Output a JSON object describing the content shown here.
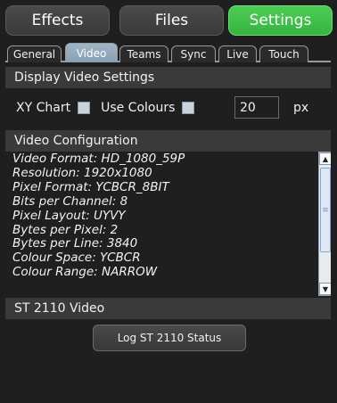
{
  "modes": [
    {
      "label": "Effects",
      "active": false
    },
    {
      "label": "Files",
      "active": false
    },
    {
      "label": "Settings",
      "active": true
    }
  ],
  "subtabs": [
    {
      "label": "General",
      "active": false
    },
    {
      "label": "Video",
      "active": true
    },
    {
      "label": "Teams",
      "active": false
    },
    {
      "label": "Sync",
      "active": false
    },
    {
      "label": "Live",
      "active": false
    },
    {
      "label": "Touch",
      "active": false
    }
  ],
  "display": {
    "header": "Display Video Settings",
    "xy_chart_label": "XY Chart",
    "xy_chart_checked": false,
    "use_colours_label": "Use Colours",
    "use_colours_checked": false,
    "size_value": "20",
    "size_unit": "px"
  },
  "config": {
    "header": "Video Configuration",
    "lines": [
      "Video Format: HD_1080_59P",
      "Resolution: 1920x1080",
      "Pixel Format: YCBCR_8BIT",
      "Bits per Channel: 8",
      "Pixel Layout: UYVY",
      "Bytes per Pixel: 2",
      "Bytes per Line: 3840",
      "Colour Space: YCBCR",
      "Colour Range: NARROW"
    ]
  },
  "st2110": {
    "header": "ST 2110 Video",
    "log_button": "Log ST 2110 Status"
  },
  "colors": {
    "background": "#1f1f1f",
    "active_mode": "#3fc049",
    "active_tab": "#8fa7ba"
  }
}
